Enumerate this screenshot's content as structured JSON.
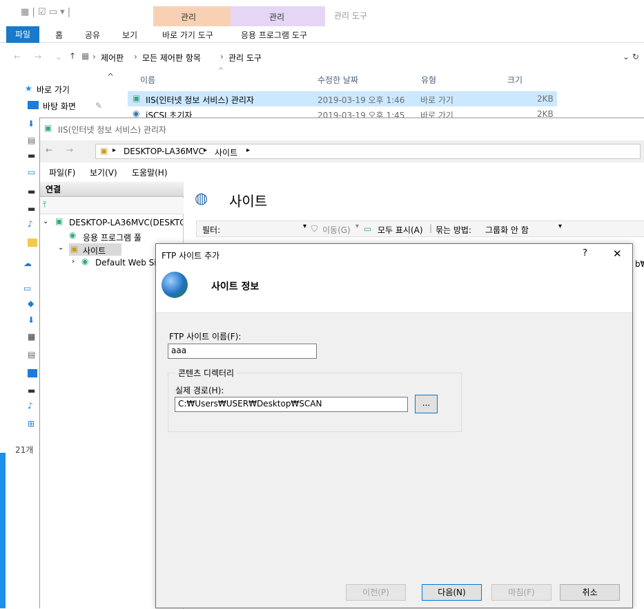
{
  "explorer": {
    "ctx_tab_1": "관리",
    "ctx_tab_2": "관리",
    "window_title": "관리 도구",
    "tabs": [
      "파일",
      "홈",
      "공유",
      "보기",
      "바로 가기 도구",
      "응용 프로그램 도구"
    ],
    "breadcrumb": [
      "제어판",
      "모든 제어판 항목",
      "관리 도구"
    ],
    "nav": [
      "바로 가기",
      "바탕 화면"
    ],
    "columns": [
      "이름",
      "수정한 날짜",
      "유형",
      "크기"
    ],
    "rows": [
      {
        "name": "IIS(인터넷 정보 서비스) 관리자",
        "date": "2019-03-19 오후 1:46",
        "type": "바로 가기",
        "size": "2KB"
      },
      {
        "name": "iSCSI 초기자",
        "date": "2019-03-19 오후 1:45",
        "type": "바로 가기",
        "size": "2KB"
      }
    ],
    "item_count": "21개"
  },
  "iis": {
    "title": "IIS(인터넷 정보 서비스) 관리자",
    "address": [
      "DESKTOP-LA36MVC",
      "사이트"
    ],
    "menu": [
      "파일(F)",
      "보기(V)",
      "도움말(H)"
    ],
    "connections_label": "연결",
    "tree": [
      "DESKTOP-LA36MVC(DESKTO",
      "응용 프로그램 풀",
      "사이트",
      "Default Web Si"
    ],
    "pane_title": "사이트",
    "filter_label": "필터:",
    "filter_go": "이동(G)",
    "show_all": "모두 표시(A)",
    "group_by_label": "묶는 방법:",
    "group_by_value": "그룹화 안 함",
    "right_edge_text": "b₩"
  },
  "dialog": {
    "title": "FTP 사이트 추가",
    "help": "?",
    "close": "✕",
    "header": "사이트 정보",
    "site_name_label": "FTP 사이트 이름(F):",
    "site_name_value": "aaa",
    "content_dir_label": "콘텐츠 디렉터리",
    "physical_path_label": "실제 경로(H):",
    "physical_path_value": "C:₩Users₩USER₩Desktop₩SCAN",
    "browse": "...",
    "buttons": {
      "prev": "이전(P)",
      "next": "다음(N)",
      "finish": "마침(F)",
      "cancel": "취소"
    }
  }
}
